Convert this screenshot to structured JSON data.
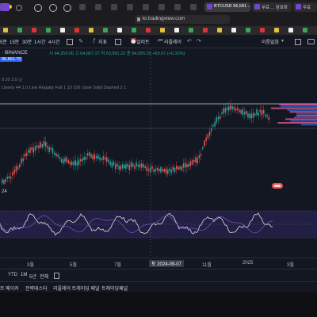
{
  "browser": {
    "url": "kr.tradingview.com",
    "tabs": [
      {
        "label": "BTCUSD 96,581..."
      },
      {
        "label": "무료 ... 암호화"
      },
      {
        "label": "무료"
      }
    ]
  },
  "toolbar": {
    "intervals": [
      "5분",
      "15분",
      "30분",
      "1시간",
      "4시간"
    ],
    "indicators_label": "지표",
    "alert_label": "얼러트",
    "replay_label": "리플레이",
    "unnamed_label": "이름없음"
  },
  "legend": {
    "symbol": "· BINANCE",
    "price_box": "96,861.70",
    "ohlc": "시 64,259.00  고 64,867.17  저 63,991.22  종 64,055.25  +60.07 (+0.10%)",
    "indicator_line1": "0 20 2.5 ◎",
    "indicator_line2": "Liberty 44 1.0 Line Regular Full 1 10 100 close Solid Dashed 2 1"
  },
  "rsi_label": "24",
  "x_axis": {
    "labels": [
      "3월",
      "5월",
      "7월",
      "11월",
      "2025",
      "3월"
    ],
    "crosshair_label": "토 2024-09-07"
  },
  "bottom_toolbar": {
    "ranges": [
      "YTD",
      "1M",
      "5년",
      "전체"
    ]
  },
  "panels": [
    "트 메이커",
    "전략테스터",
    "리플레이 트레이딩 패널",
    "트레이딩패널"
  ],
  "colors": {
    "bull": "#26a69a",
    "bear": "#ef5350",
    "rsi_band": "#2a2453",
    "rsi_line": "#c9c9c9",
    "rsi_signal": "#7e57c2"
  }
}
